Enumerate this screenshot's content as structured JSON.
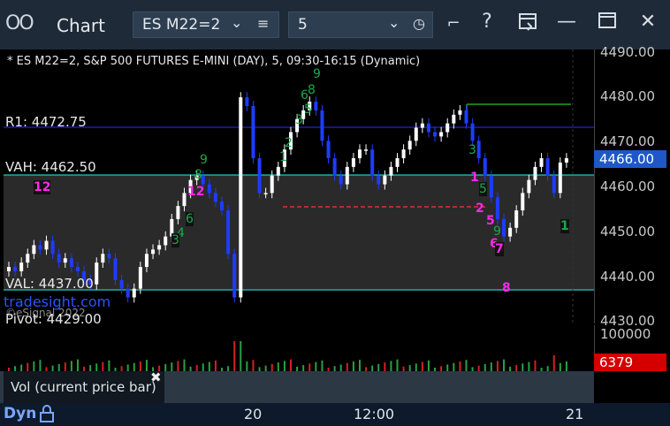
{
  "window": {
    "title": "Chart",
    "icon": "chart-window-icon",
    "symbol_select": "ES M22=2",
    "interval_select": "5",
    "buttons": [
      "menu-icon",
      "clock-icon",
      "pin-icon",
      "help-icon",
      "export-icon",
      "minimize-icon",
      "maximize-icon",
      "close-icon"
    ],
    "help_label": "?"
  },
  "chart": {
    "header": "* ES M22=2, S&P 500 FUTURES E-MINI (DAY), 5, 09:30-16:15 (Dynamic)",
    "levels": {
      "r1": "R1: 4472.75",
      "vah": "VAH: 4462.50",
      "val": "VAL: 4437.00",
      "pivot": "Pivot: 4429.00"
    },
    "watermark": "tradesight.com",
    "watermark2": "©eSignal 2022",
    "current_price": "4466.00",
    "y_ticks": [
      "4490.00",
      "4480.00",
      "4470.00",
      "4460.00",
      "4450.00",
      "4440.00",
      "4430.00"
    ],
    "td_labels": {
      "magenta_12_left": "12",
      "magenta_12_mid": "12",
      "magenta_1": "1",
      "magenta_2": "2",
      "magenta_5": "5",
      "magenta_6": "6",
      "magenta_7": "7",
      "magenta_8": "8",
      "green_9_top": "9",
      "green_9_mid": "9",
      "green_8_top": "8",
      "green_6_top": "6",
      "green_5_top": "5",
      "green_3_top": "3",
      "green_2_top": "2",
      "green_1_top": "1",
      "green_1_right": "1",
      "green_3_mid": "3",
      "green_4_left": "4",
      "green_6_left": "6",
      "green_8_left": "8",
      "green_3_right": "3",
      "green_5_right": "5",
      "green_9_right": "9"
    }
  },
  "chart_data": {
    "type": "bar",
    "title": "* ES M22=2, S&P 500 FUTURES E-MINI (DAY), 5, 09:30-16:15 (Dynamic)",
    "ylim": [
      4428,
      4491
    ],
    "x_ticks": [
      "20",
      "12:00",
      "21"
    ],
    "series": [
      {
        "name": "",
        "values": [
          4441,
          4440,
          4442,
          4444,
          4446,
          4445,
          4447,
          4444,
          4442,
          4443,
          4441,
          4440,
          4438,
          4437,
          4442,
          4444,
          4443,
          4438,
          4436,
          4434,
          4436,
          4441,
          4444,
          4445,
          4446,
          4448,
          4452,
          4455,
          4458,
          4461,
          4462,
          4460,
          4458,
          4456,
          4454,
          4444,
          4434,
          4480,
          4478,
          4466,
          4458,
          4458,
          4462,
          4464,
          4468,
          4472,
          4475,
          4477,
          4479,
          4477,
          4470,
          4466,
          4462,
          4460,
          4464,
          4466,
          4468,
          4468,
          4462,
          4460,
          4462,
          4464,
          4466,
          4468,
          4470,
          4473,
          4474,
          4472,
          4471,
          4472,
          4474,
          4476,
          4477,
          4474,
          4470,
          4466,
          4462,
          4457,
          4452,
          4448,
          4450,
          4454,
          4458,
          4461,
          4464,
          4466,
          4462,
          4458,
          4465,
          4466
        ]
      }
    ]
  },
  "volume": {
    "axis_top": "100000",
    "current_volume": "6379",
    "panel_label": "Vol (current price bar)",
    "close_label": "✖"
  },
  "status": {
    "mode": "Dyn",
    "lock_icon": "lock-icon",
    "x_labels": [
      "20",
      "12:00",
      "21"
    ]
  },
  "colors": {
    "up_bar": "#ffffff",
    "down_bar": "#1e3cff",
    "r1_line": "#2222dd",
    "vah_line": "#20c8c8",
    "val_line": "#20c8c8",
    "pivot_red": "#e03030",
    "green_line": "#20a020",
    "td_magenta": "#ff28e8",
    "td_green": "#1aa84a",
    "price_tag": "#1f57c8",
    "volume_tag": "#d40000"
  }
}
